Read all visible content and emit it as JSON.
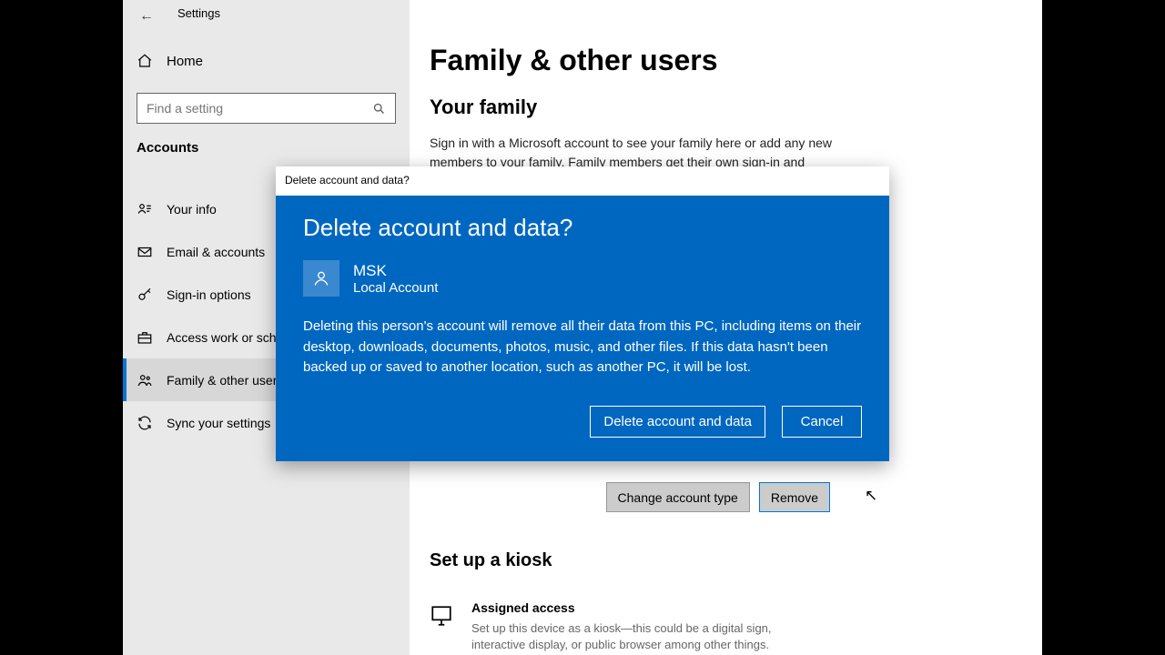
{
  "window": {
    "title": "Settings"
  },
  "sidebar": {
    "home": "Home",
    "search_placeholder": "Find a setting",
    "category": "Accounts",
    "items": [
      {
        "label": "Your info"
      },
      {
        "label": "Email & accounts"
      },
      {
        "label": "Sign-in options"
      },
      {
        "label": "Access work or school"
      },
      {
        "label": "Family & other users"
      },
      {
        "label": "Sync your settings"
      }
    ]
  },
  "main": {
    "title": "Family & other users",
    "family_heading": "Your family",
    "family_text": "Sign in with a Microsoft account to see your family here or add any new members to your family. Family members get their own sign-in and",
    "change_btn": "Change account type",
    "remove_btn": "Remove",
    "kiosk_heading": "Set up a kiosk",
    "kiosk_title": "Assigned access",
    "kiosk_text": "Set up this device as a kiosk—this could be a digital sign, interactive display, or public browser among other things."
  },
  "modal": {
    "titlebar": "Delete account and data?",
    "heading": "Delete account and data?",
    "account_name": "MSK",
    "account_type": "Local Account",
    "body": "Deleting this person's account will remove all their data from this PC, including items on their desktop, downloads, documents, photos, music, and other files. If this data hasn't been backed up or saved to another location, such as another PC, it will be lost.",
    "primary_btn": "Delete account and data",
    "cancel_btn": "Cancel"
  }
}
